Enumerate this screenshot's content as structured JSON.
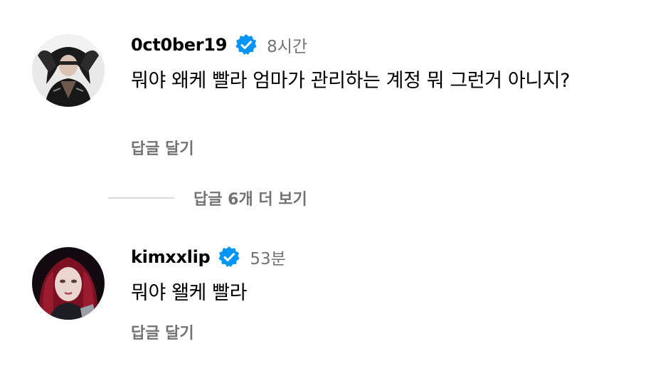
{
  "comments": [
    {
      "username": "0ct0ber19",
      "verified_icon": "verified-badge-icon",
      "time": "8시간",
      "text": "뭐야 왜케 빨라 엄마가 관리하는 계정 뭐 그런거 아니지?",
      "reply_label": "답글 달기"
    },
    {
      "username": "kimxxlip",
      "verified_icon": "verified-badge-icon",
      "time": "53분",
      "text": "뭐야 왤케 빨라",
      "reply_label": "답글 달기"
    }
  ],
  "view_replies": {
    "label": "답글 6개 더 보기"
  },
  "colors": {
    "verified_blue": "#0095f6",
    "secondary_text": "#737373",
    "divider": "#dbdbdb"
  }
}
